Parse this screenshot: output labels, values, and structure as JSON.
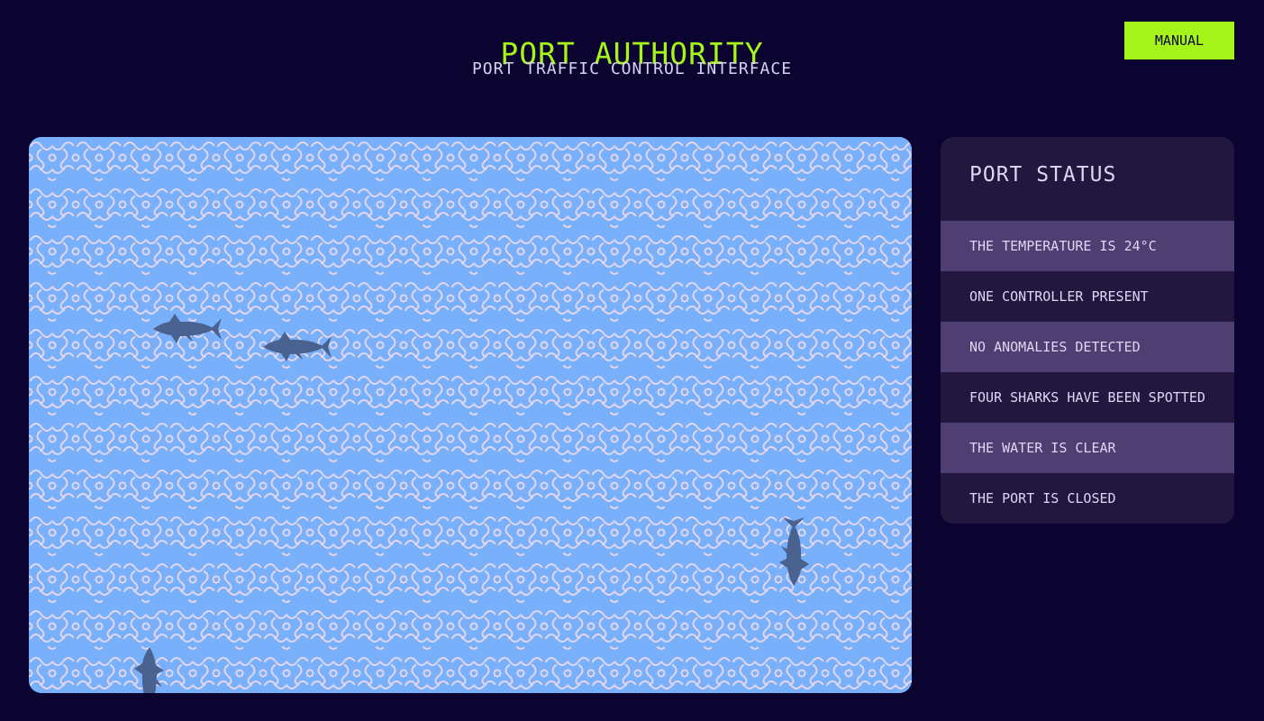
{
  "header": {
    "title": "PORT AUTHORITY",
    "subtitle": "PORT TRAFFIC CONTROL INTERFACE",
    "manual_button": "MANUAL"
  },
  "colors": {
    "background": "#0c0430",
    "accent": "#a6f51a",
    "water": "#78b0fb",
    "wave": "#e4d6ec",
    "shark": "#49628f",
    "panel": "#22183f",
    "panel_row_alt": "#4f3e72",
    "text": "#ddd6f4"
  },
  "map": {
    "sharks": [
      {
        "name": "shark-1",
        "heading": "west"
      },
      {
        "name": "shark-2",
        "heading": "west"
      },
      {
        "name": "shark-3",
        "heading": "south"
      },
      {
        "name": "shark-4",
        "heading": "north"
      }
    ]
  },
  "status": {
    "title": "PORT STATUS",
    "items": [
      "THE TEMPERATURE IS 24°C",
      "ONE CONTROLLER PRESENT",
      "NO ANOMALIES DETECTED",
      "FOUR SHARKS HAVE BEEN SPOTTED",
      "THE WATER IS CLEAR",
      "THE PORT IS CLOSED"
    ]
  }
}
